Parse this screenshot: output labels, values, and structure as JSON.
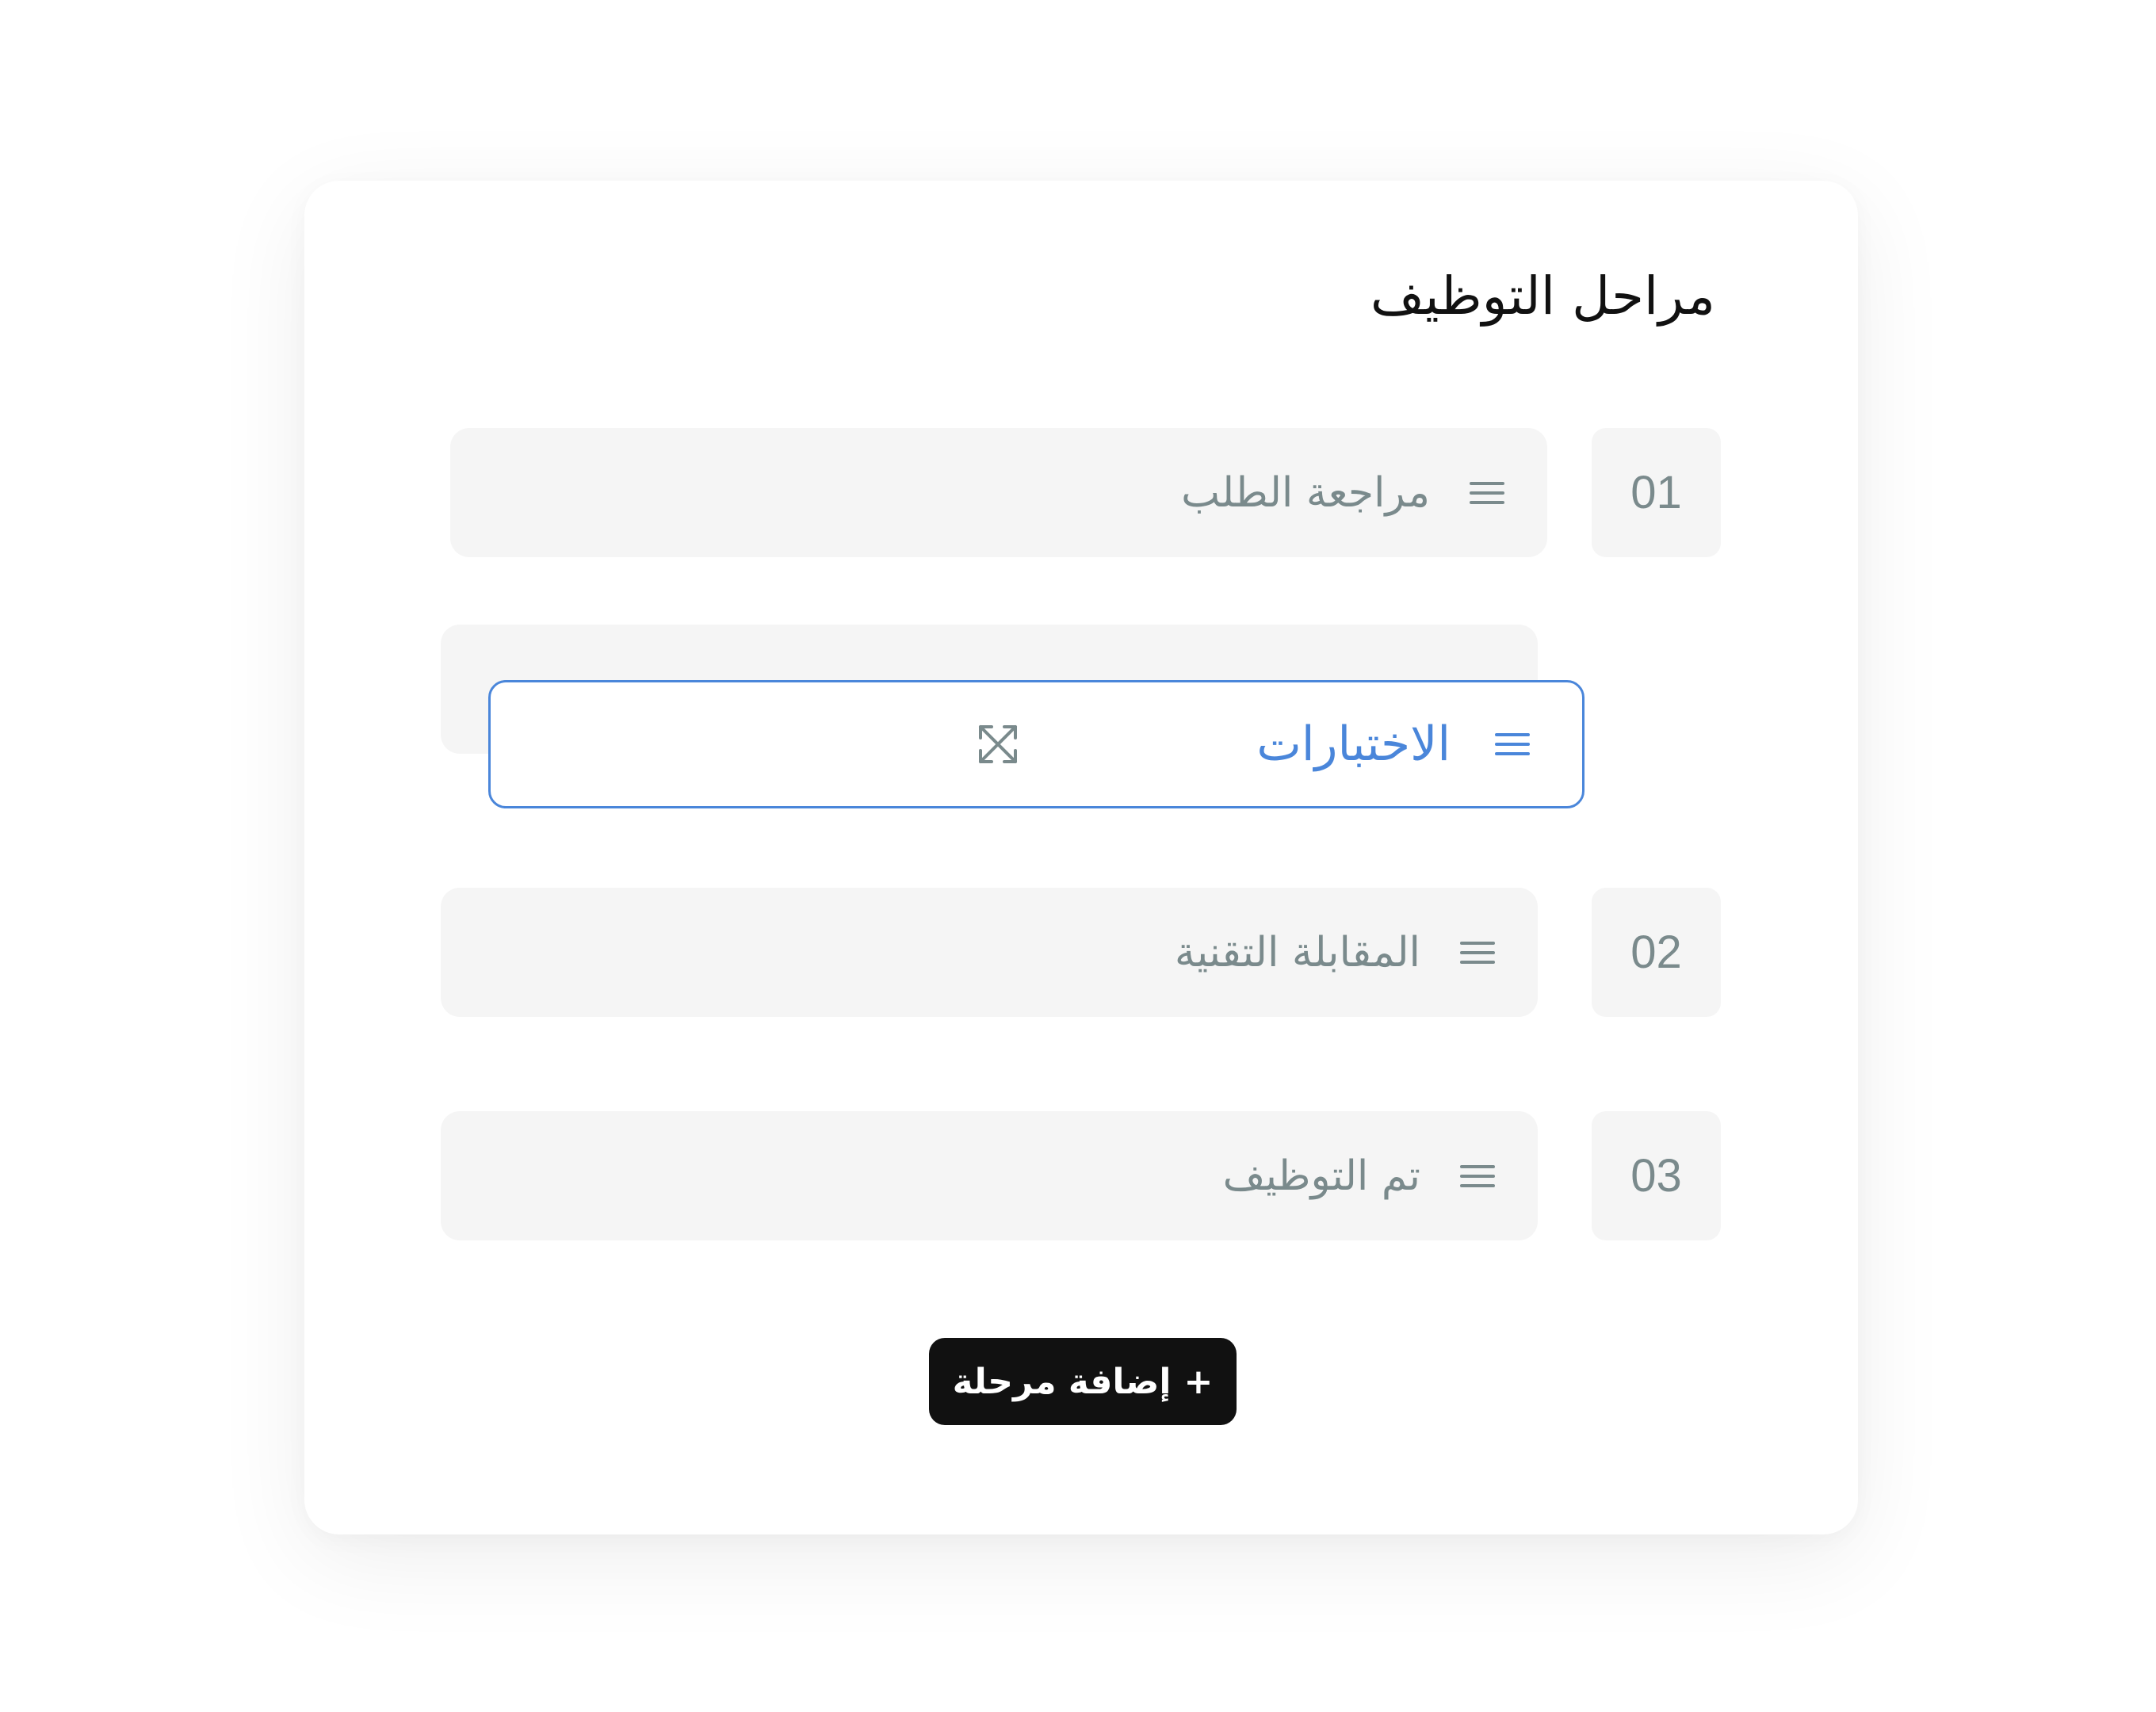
{
  "page": {
    "title": "مراحل التوظيف"
  },
  "stages": [
    {
      "number": "01",
      "label": "مراجعة الطلب"
    },
    {
      "number": "02",
      "label": "المقابلة التقنية"
    },
    {
      "number": "03",
      "label": "تم التوظيف"
    }
  ],
  "dragging": {
    "label": "الاختبارات"
  },
  "add_button": {
    "icon": "+",
    "label": "إضافة مرحلة"
  },
  "colors": {
    "accent": "#4a86da",
    "muted_text": "#7a8a8c",
    "row_background": "#f5f5f5",
    "button_background": "#111111"
  }
}
